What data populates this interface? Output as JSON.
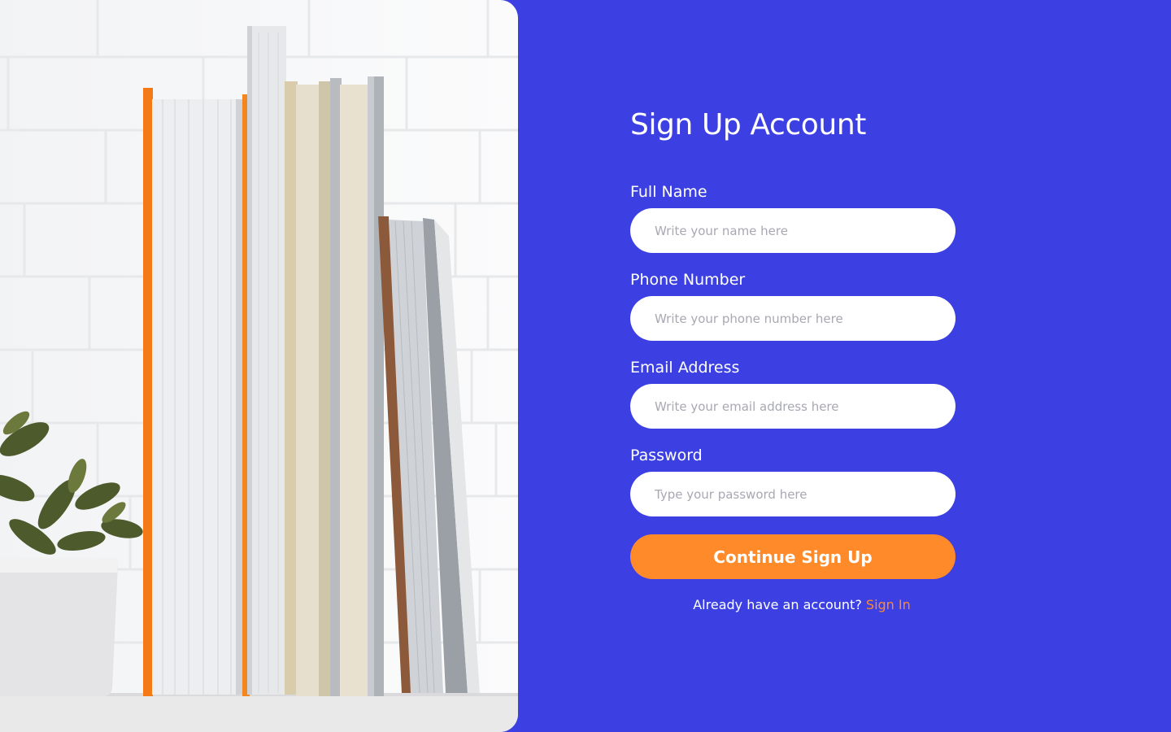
{
  "colors": {
    "background": "#3c40e2",
    "accent": "#ff8a2a",
    "input_background": "#ffffff",
    "text": "#ffffff",
    "placeholder": "#a8a8b3"
  },
  "hero_image": {
    "subject": "books-and-plant-photo"
  },
  "form": {
    "title": "Sign Up Account",
    "fields": [
      {
        "label": "Full Name",
        "value": "",
        "placeholder": "Write your name here"
      },
      {
        "label": "Phone Number",
        "value": "",
        "placeholder": "Write your phone number here"
      },
      {
        "label": "Email Address",
        "value": "",
        "placeholder": "Write your email address here"
      },
      {
        "label": "Password",
        "value": "",
        "placeholder": "Type your password here"
      }
    ],
    "submit_label": "Continue Sign Up",
    "signin_prompt": "Already have an account?",
    "signin_link": "Sign In"
  }
}
